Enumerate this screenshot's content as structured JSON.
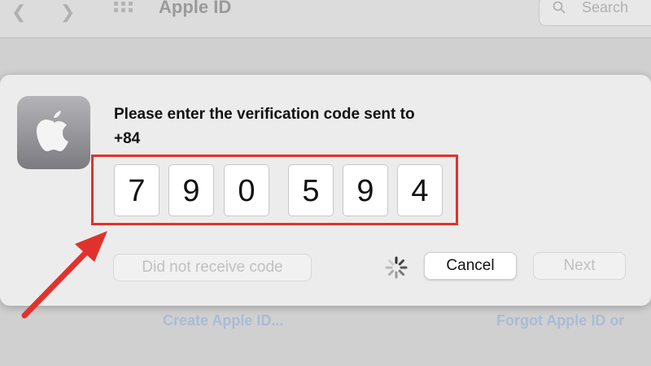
{
  "window": {
    "title": "Apple ID",
    "search_placeholder": "Search",
    "links": {
      "create": "Create Apple ID...",
      "forgot": "Forgot Apple ID or"
    }
  },
  "dialog": {
    "prompt_line1": "Please enter the verification code sent to",
    "prompt_line2": "+84",
    "code_digits": [
      "7",
      "9",
      "0",
      "5",
      "9",
      "4"
    ],
    "buttons": {
      "resend": "Did not receive code",
      "cancel": "Cancel",
      "next": "Next"
    }
  },
  "icons": {
    "app": "apple-logo-icon",
    "loading": "spinner-icon",
    "annotation": "red-arrow-icon"
  },
  "colors": {
    "highlight": "#e0322c"
  }
}
